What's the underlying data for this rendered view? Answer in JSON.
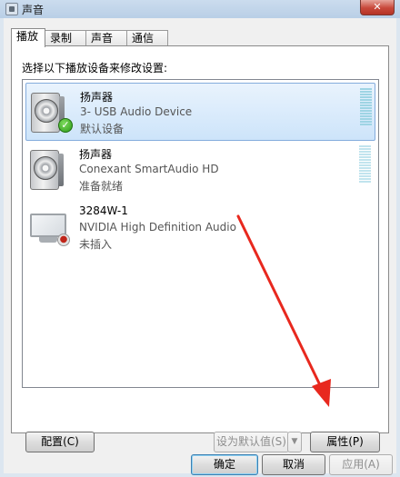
{
  "window": {
    "title": "声音",
    "close_label": "✕"
  },
  "tabs": [
    {
      "label": "播放",
      "active": true
    },
    {
      "label": "录制",
      "active": false
    },
    {
      "label": "声音",
      "active": false
    },
    {
      "label": "通信",
      "active": false
    }
  ],
  "panel": {
    "instruction": "选择以下播放设备来修改设置:"
  },
  "devices": [
    {
      "name": "扬声器",
      "description": "3- USB Audio Device",
      "status": "默认设备",
      "icon": "speaker-icon",
      "badge": "green-check-icon",
      "selected": true
    },
    {
      "name": "扬声器",
      "description": "Conexant SmartAudio HD",
      "status": "准备就绪",
      "icon": "speaker-icon",
      "badge": "",
      "selected": false
    },
    {
      "name": "3284W-1",
      "description": "NVIDIA High Definition Audio",
      "status": "未插入",
      "icon": "monitor-icon",
      "badge": "unplugged-icon",
      "selected": false
    }
  ],
  "buttons": {
    "configure": "配置(C)",
    "set_default": "设为默认值(S)",
    "set_default_arrow": "▼",
    "properties": "属性(P)",
    "ok": "确定",
    "cancel": "取消",
    "apply": "应用(A)"
  },
  "colors": {
    "annotation_arrow": "#e8281e",
    "selection_border": "#84acdd",
    "level_meter": "#9ed4e4"
  }
}
